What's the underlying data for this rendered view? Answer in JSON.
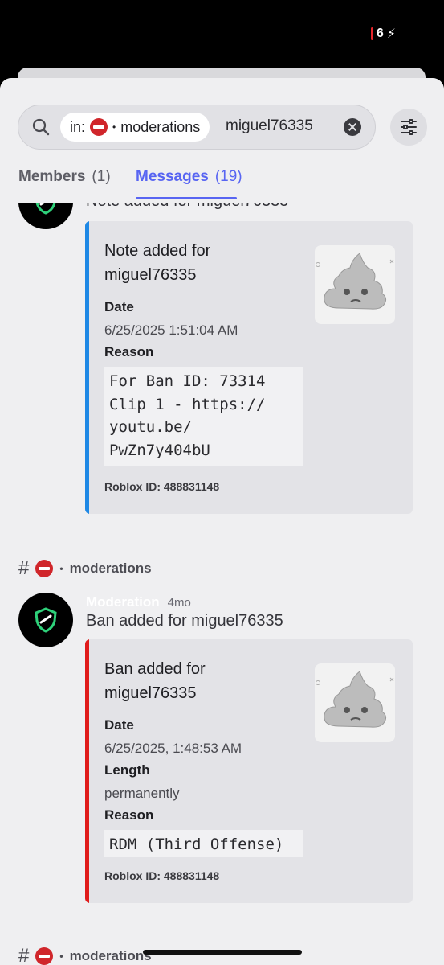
{
  "status_bar": {
    "battery_text": "6"
  },
  "search": {
    "filter_prefix": "in:",
    "channel_name": "moderations",
    "query": "miguel76335"
  },
  "tabs": [
    {
      "label": "Members",
      "count": "(1)"
    },
    {
      "label": "Messages",
      "count": "(19)"
    }
  ],
  "colors": {
    "accent": "#5865f2",
    "note_stripe": "#1e88e5",
    "ban_stripe": "#e01b1b",
    "avatar_shield": "#2ed17a"
  },
  "messages": [
    {
      "content_partial": "Note added for miguel76335",
      "embed": {
        "title": "Note added for miguel76335",
        "fields": [
          {
            "name": "Date",
            "value": "6/25/2025 1:51:04 AM"
          },
          {
            "name": "Reason",
            "code": "For Ban ID: 73314\nClip 1 - https://\nyoutu.be/\nPwZn7y404bU"
          }
        ],
        "footer": "Roblox ID: 488831148"
      }
    },
    {
      "channel": "moderations",
      "author": "Moderation",
      "time": "4mo",
      "content": "Ban added for miguel76335",
      "embed": {
        "title": "Ban added for miguel76335",
        "fields": [
          {
            "name": "Date",
            "value": "6/25/2025, 1:48:53 AM"
          },
          {
            "name": "Length",
            "value": "permanently"
          },
          {
            "name": "Reason",
            "code": "RDM (Third Offense)"
          }
        ],
        "footer": "Roblox ID: 488831148"
      }
    },
    {
      "channel": "moderations"
    }
  ]
}
